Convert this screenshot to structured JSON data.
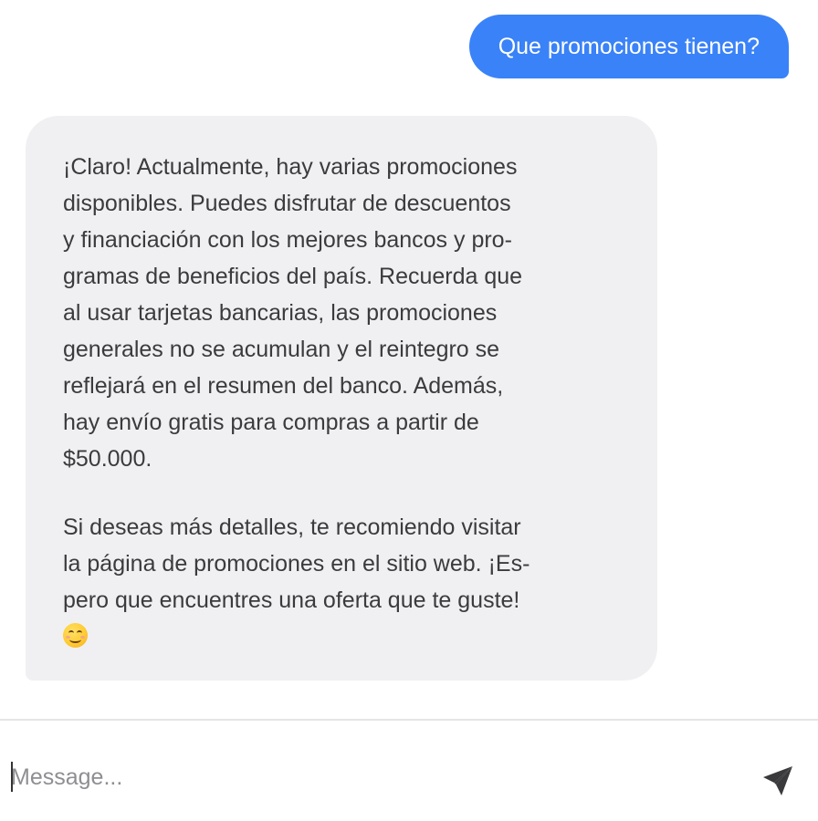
{
  "messages": {
    "user": {
      "text": "Que promociones tienen?"
    },
    "assistant": {
      "paragraph_1": "¡Claro! Actualmente, hay varias promociones\ndisponibles. Puedes disfrutar de descuentos\ny financiación con los mejores bancos y pro-\ngramas de beneficios del país. Recuerda que\nal usar tarjetas bancarias, las promociones\ngenerales no se acumulan y el reintegro se\nreflejará en el resumen del banco. Además,\nhay envío gratis para compras a partir de\n$50.000.",
      "paragraph_2": "Si deseas más detalles, te recomiendo visitar\nla página de promociones en el sitio web. ¡Es-\npero que encuentres una oferta que te guste!",
      "emoji": "smiling-face-icon"
    }
  },
  "composer": {
    "placeholder": "Message...",
    "value": "",
    "send_icon": "send-icon"
  },
  "colors": {
    "user_bubble": "#3a82f7",
    "assistant_bubble": "#f0f0f2",
    "send_icon": "#3a3a3c"
  }
}
